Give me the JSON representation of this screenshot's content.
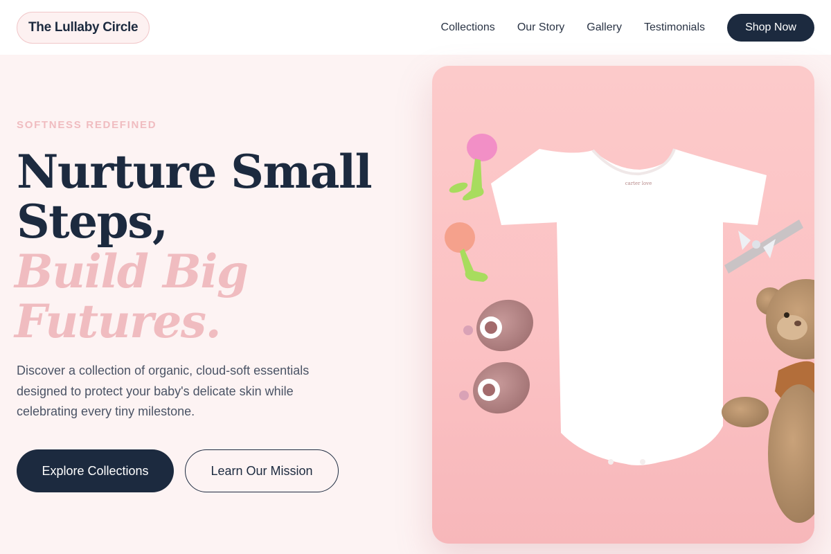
{
  "brand": {
    "name": "The Lullaby Circle"
  },
  "nav": {
    "items": [
      {
        "label": "Collections"
      },
      {
        "label": "Our Story"
      },
      {
        "label": "Gallery"
      },
      {
        "label": "Testimonials"
      }
    ],
    "cta_label": "Shop Now"
  },
  "hero": {
    "eyebrow": "SOFTNESS REDEFINED",
    "headline": {
      "line1": "Nurture Small",
      "line2": "Steps,",
      "accent_line1": "Build Big",
      "accent_line2": "Futures."
    },
    "description": "Discover a collection of organic, cloud-soft essentials designed to protect your baby's delicate skin while celebrating every tiny milestone.",
    "primary_button": "Explore Collections",
    "secondary_button": "Learn Our Mission",
    "image": {
      "subject": "baby-clothing-flatlay-icon",
      "tag_text": "carter love"
    }
  },
  "colors": {
    "navy": "#1c2a3f",
    "blush": "#f0bcc0",
    "background": "#fdf3f3",
    "photo_pink": "#fbc6c7"
  }
}
